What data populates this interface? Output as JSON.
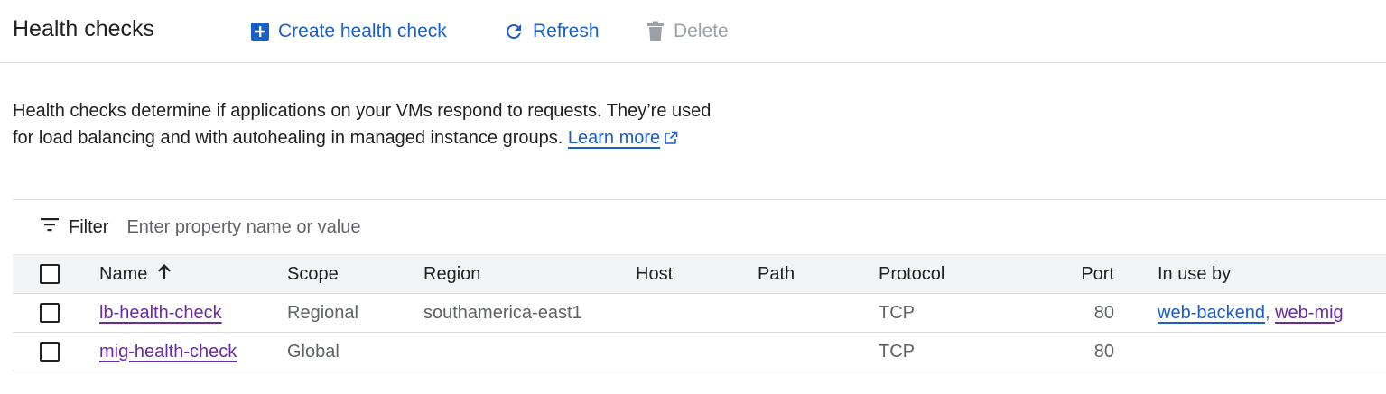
{
  "header": {
    "title": "Health checks",
    "actions": [
      {
        "label": "Create health check",
        "icon": "add-box-icon",
        "enabled": true
      },
      {
        "label": "Refresh",
        "icon": "refresh-icon",
        "enabled": true
      },
      {
        "label": "Delete",
        "icon": "trash-icon",
        "enabled": false
      }
    ]
  },
  "description": {
    "text": "Health checks determine if applications on your VMs respond to requests. They’re used for load balancing and with autohealing in managed instance groups.",
    "link_label": "Learn more",
    "link_icon": "external-link-icon"
  },
  "filter": {
    "label": "Filter",
    "placeholder": "Enter property name or value",
    "icon": "filter-list-icon"
  },
  "table": {
    "columns": {
      "name": "Name",
      "scope": "Scope",
      "region": "Region",
      "host": "Host",
      "path": "Path",
      "protocol": "Protocol",
      "port": "Port",
      "in_use_by": "In use by"
    },
    "sort": {
      "column": "Name",
      "direction": "ascending",
      "icon": "arrow-up-icon"
    },
    "rows": [
      {
        "name": "lb-health-check",
        "scope": "Regional",
        "region": "southamerica-east1",
        "host": "",
        "path": "",
        "protocol": "TCP",
        "port": "80",
        "in_use_by": [
          "web-backend",
          "web-mig"
        ],
        "in_use_by_separator": ","
      },
      {
        "name": "mig-health-check",
        "scope": "Global",
        "region": "",
        "host": "",
        "path": "",
        "protocol": "TCP",
        "port": "80",
        "in_use_by": []
      }
    ]
  },
  "colors": {
    "accent": "#1a5fc8",
    "visited_link": "#6b2aa0",
    "disabled": "#9aa0a6",
    "header_bg": "#f1f3f4",
    "divider": "#dadce0"
  }
}
